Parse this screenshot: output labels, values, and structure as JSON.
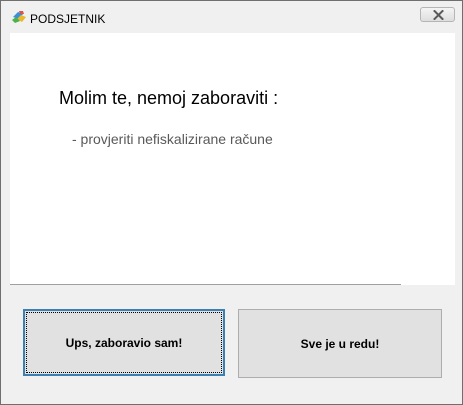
{
  "window": {
    "title": "PODSJETNIK",
    "close_icon": "close-icon"
  },
  "message": {
    "heading": "Molim te, nemoj zaboraviti :",
    "item": "- provjeriti nefiskalizirane račune"
  },
  "buttons": {
    "forgot_label": "Ups, zaboravio sam!",
    "ok_label": "Sve je u redu!"
  },
  "colors": {
    "focus_border": "#3c7fb1",
    "button_face": "#e1e1e1",
    "item_text": "#595959"
  }
}
